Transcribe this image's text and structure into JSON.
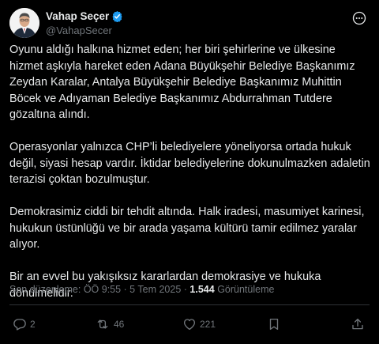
{
  "colors": {
    "background": "#000000",
    "text_primary": "#e7e9ea",
    "text_secondary": "#71767b",
    "verified_badge": "#1d9bf0",
    "divider": "#2f3336"
  },
  "author": {
    "display_name": "Vahap Seçer",
    "handle": "@VahapSecer",
    "verified": true,
    "avatar_icon": "avatar-photo"
  },
  "tweet": {
    "paragraphs": [
      "Oyunu aldığı halkına hizmet eden; her biri şehirlerine ve ülkesine hizmet aşkıyla hareket eden Adana Büyükşehir Belediye Başkanımız Zeydan Karalar, Antalya Büyükşehir Belediye Başkanımız Muhittin Böcek ve Adıyaman Belediye Başkanımız Abdurrahman Tutdere gözaltına alındı.",
      "Operasyonlar yalnızca CHP’li belediyelere yöneliyorsa ortada hukuk değil, siyasi hesap vardır. İktidar belediyelerine dokunulmazken adaletin terazisi çoktan bozulmuştur.",
      "Demokrasimiz ciddi bir tehdit altında. Halk iradesi, masumiyet karinesi, hukukun üstünlüğü ve bir arada yaşama kültürü tamir edilmez yaralar alıyor.",
      "Bir an evvel bu yakışıksız kararlardan demokrasiye ve hukuka dönülmelidir."
    ],
    "meta": {
      "edited_label": "Son düzenleme:",
      "timestamp": "ÖÖ 9:55 · 5 Tem 2025",
      "separator": "·",
      "views_count": "1.544",
      "views_label": "Görüntüleme"
    }
  },
  "actions": {
    "reply": {
      "icon": "reply-icon",
      "count": "2"
    },
    "repost": {
      "icon": "repost-icon",
      "count": "46"
    },
    "like": {
      "icon": "like-icon",
      "count": "221"
    },
    "bookmark": {
      "icon": "bookmark-icon"
    },
    "share": {
      "icon": "share-icon"
    }
  },
  "more_icon": "more-options-icon"
}
